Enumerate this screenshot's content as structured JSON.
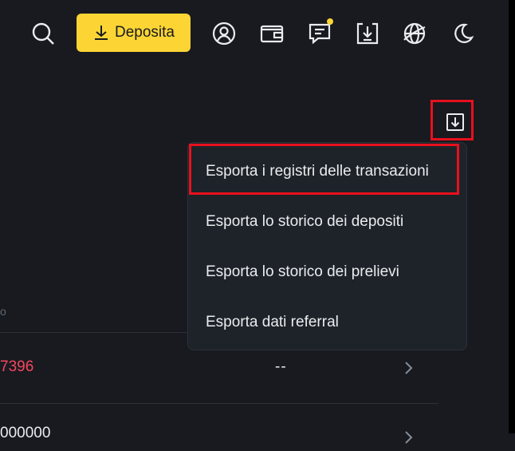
{
  "header": {
    "icons": [
      "search-icon",
      "user-icon",
      "wallet-icon",
      "message-icon",
      "download-icon",
      "globe-icon",
      "moon-icon"
    ],
    "deposit_label": "Deposita",
    "accent": "#fcd535"
  },
  "export_menu": {
    "items": [
      "Esporta i registri delle transazioni",
      "Esporta lo storico dei depositi",
      "Esporta lo storico dei prelievi",
      "Esporta dati referral"
    ]
  },
  "table": {
    "header_fragment": "o",
    "rows": [
      {
        "value": "7396",
        "status": "--"
      },
      {
        "value": "000000",
        "status": ""
      }
    ]
  },
  "colors": {
    "background": "#181a20",
    "menu_bg": "#1e2329",
    "highlight": "#e8101d",
    "negative": "#f6465d"
  }
}
